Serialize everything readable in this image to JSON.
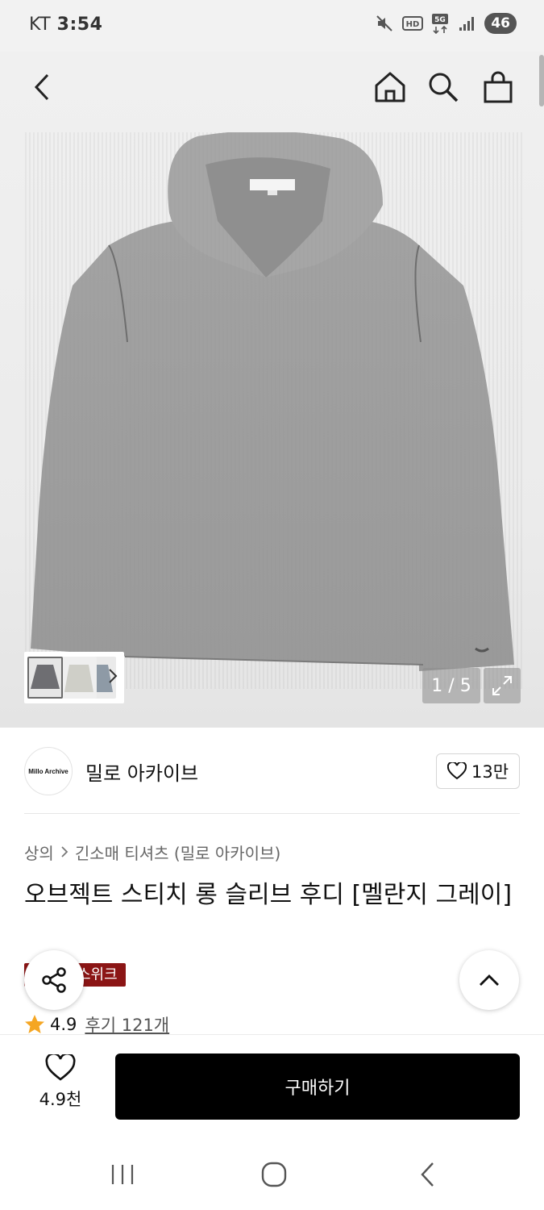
{
  "status_bar": {
    "carrier": "KT",
    "time": "3:54",
    "battery": "46"
  },
  "gallery": {
    "counter": "1 / 5"
  },
  "brand": {
    "logo_text": "Millo Archive",
    "name": "밀로 아카이브",
    "likes": "13만"
  },
  "breadcrumb": {
    "level1": "상의",
    "level2": "긴소매 티셔츠 (밀로 아카이브)"
  },
  "product": {
    "title": "오브젝트 스티치 롱 슬리브 후디 [멜란지 그레이]",
    "badge": "스위크",
    "rating": "4.9",
    "review_link": "후기 121개"
  },
  "bottom_bar": {
    "wish_count": "4.9천",
    "buy_label": "구매하기"
  },
  "colors": {
    "badge_red": "#8b1515",
    "buy_black": "#000000",
    "star_orange": "#f5a623",
    "hoodie_gray": "#9a9a9a"
  }
}
